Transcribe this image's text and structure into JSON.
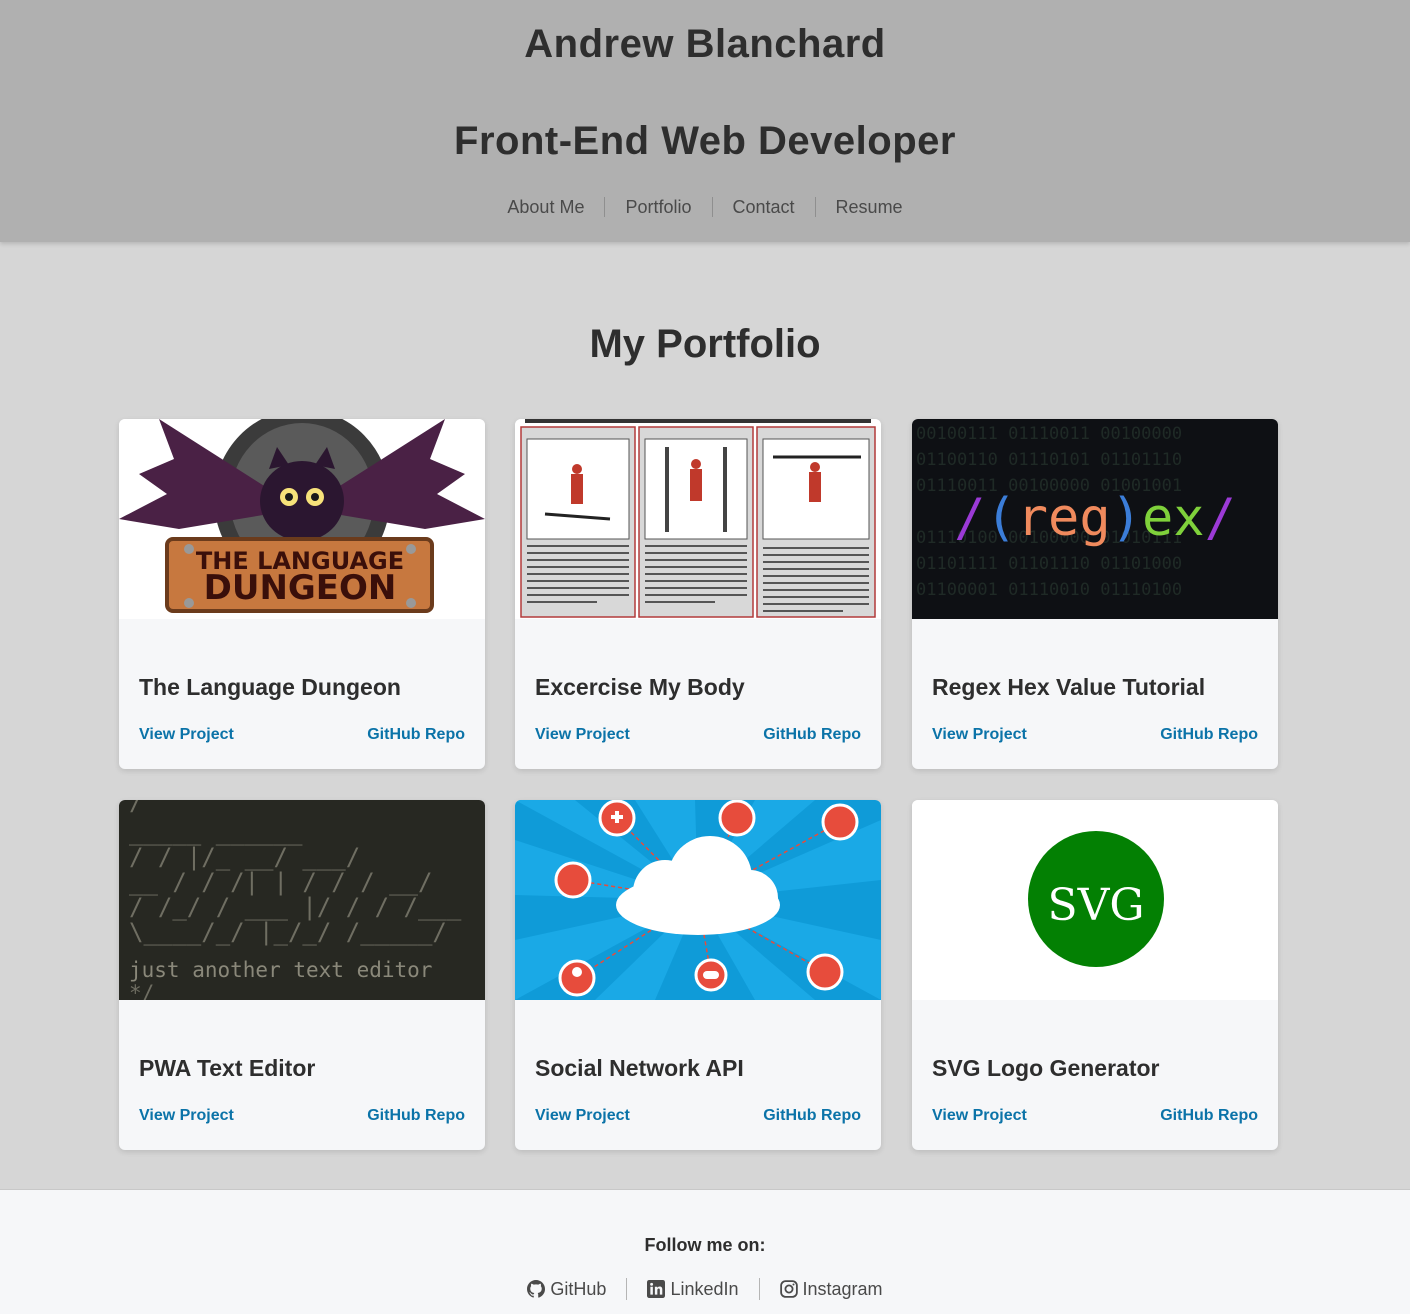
{
  "header": {
    "name": "Andrew Blanchard",
    "role": "Front-End Web Developer",
    "nav": [
      {
        "label": "About Me"
      },
      {
        "label": "Portfolio"
      },
      {
        "label": "Contact"
      },
      {
        "label": "Resume"
      }
    ]
  },
  "main": {
    "section_title": "My Portfolio",
    "projects": [
      {
        "title": "The Language Dungeon",
        "view_label": "View Project",
        "repo_label": "GitHub Repo",
        "image_text": [
          "THE LANGUAGE",
          "DUNGEON"
        ]
      },
      {
        "title": "Excercise My Body",
        "view_label": "View Project",
        "repo_label": "GitHub Repo"
      },
      {
        "title": "Regex Hex Value Tutorial",
        "view_label": "View Project",
        "repo_label": "GitHub Repo",
        "image_text": "/(reg)ex/"
      },
      {
        "title": "PWA Text Editor",
        "view_label": "View Project",
        "repo_label": "GitHub Repo",
        "image_text": "just another text editor"
      },
      {
        "title": "Social Network API",
        "view_label": "View Project",
        "repo_label": "GitHub Repo"
      },
      {
        "title": "SVG Logo Generator",
        "view_label": "View Project",
        "repo_label": "GitHub Repo",
        "image_text": "SVG"
      }
    ]
  },
  "footer": {
    "follow_label": "Follow me on:",
    "social": [
      {
        "label": "GitHub",
        "icon": "github-icon"
      },
      {
        "label": "LinkedIn",
        "icon": "linkedin-icon"
      },
      {
        "label": "Instagram",
        "icon": "instagram-icon"
      }
    ]
  },
  "colors": {
    "header_bg": "#b0b0b0",
    "page_bg": "#d6d6d6",
    "card_bg": "#f6f7f9",
    "link": "#0b73a8",
    "text": "#2e2e2e"
  }
}
